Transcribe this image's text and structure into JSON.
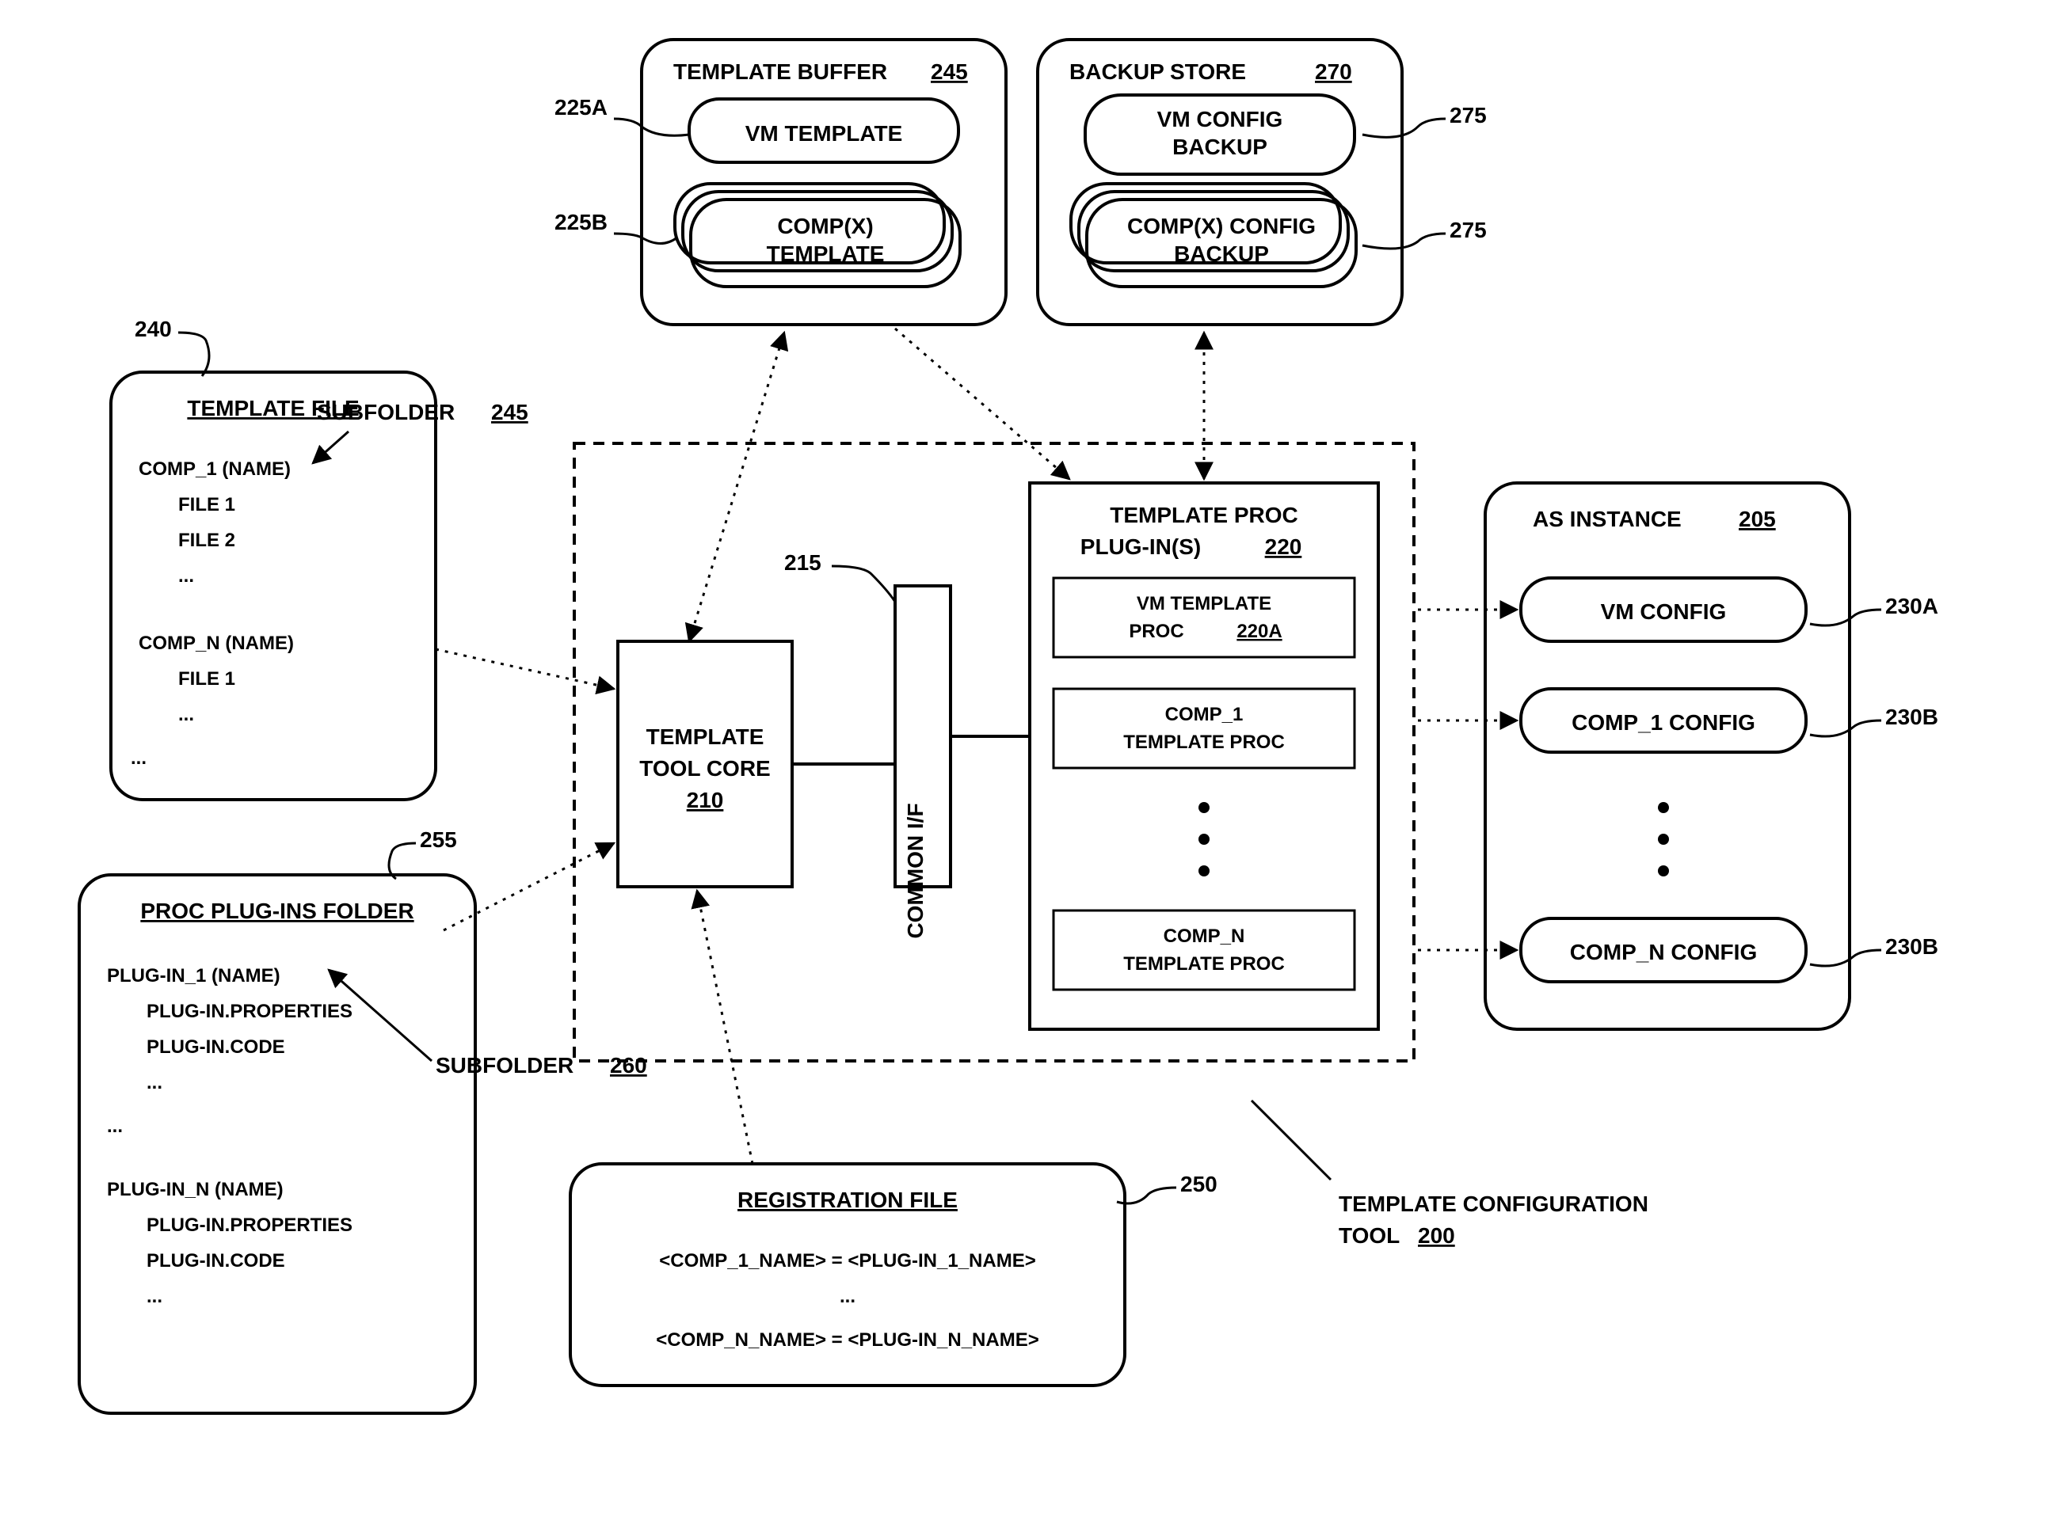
{
  "refs": {
    "r240": "240",
    "r225A": "225A",
    "r225B": "225B",
    "r245a": "245",
    "r245b": "245",
    "r270": "270",
    "r275a": "275",
    "r275b": "275",
    "r215": "215",
    "r210": "210",
    "r220": "220",
    "r220A": "220A",
    "r205": "205",
    "r230A": "230A",
    "r230Bt": "230B",
    "r230Bb": "230B",
    "r255": "255",
    "r260": "260",
    "r250": "250",
    "r200": "200"
  },
  "boxes": {
    "templateBufferTitle": "TEMPLATE BUFFER",
    "vmTemplate": "VM TEMPLATE",
    "compXTemplateL1": "COMP(X)",
    "compXTemplateL2": "TEMPLATE",
    "backupStoreTitle": "BACKUP STORE",
    "vmConfigBackupL1": "VM CONFIG",
    "vmConfigBackupL2": "BACKUP",
    "compXBackupL1": "COMP(X) CONFIG",
    "compXBackupL2": "BACKUP",
    "templateFileTitle": "TEMPLATE FILE",
    "tfComp1": "COMP_1 (NAME)",
    "tfFile1": "FILE 1",
    "tfFile2": "FILE 2",
    "tfDots": "...",
    "tfCompN": "COMP_N (NAME)",
    "tfFile1b": "FILE 1",
    "tfDots2": "...",
    "tfDots3": "...",
    "subfolderA": "SUBFOLDER",
    "toolCoreL1": "TEMPLATE",
    "toolCoreL2": "TOOL CORE",
    "commonIF": "COMMON I/F",
    "procTitleL1": "TEMPLATE PROC",
    "procTitleL2": "PLUG-IN(S)",
    "vmProcL1": "VM TEMPLATE",
    "vmProcL2": "PROC",
    "comp1ProcL1": "COMP_1",
    "comp1ProcL2": "TEMPLATE PROC",
    "compNProcL1": "COMP_N",
    "compNProcL2": "TEMPLATE PROC",
    "asInstanceTitle": "AS INSTANCE",
    "vmConfig": "VM CONFIG",
    "comp1Config": "COMP_1 CONFIG",
    "compNConfig": "COMP_N CONFIG",
    "procFolderTitle": "PROC PLUG-INS FOLDER",
    "pf1": "PLUG-IN_1 (NAME)",
    "pfProps": "PLUG-IN.PROPERTIES",
    "pfCode": "PLUG-IN.CODE",
    "pfDots": "...",
    "pfDots2": "...",
    "pfN": "PLUG-IN_N (NAME)",
    "subfolderB": "SUBFOLDER",
    "regTitle": "REGISTRATION FILE",
    "regL1": "<COMP_1_NAME> = <PLUG-IN_1_NAME>",
    "regDots": "...",
    "regL2": "<COMP_N_NAME> = <PLUG-IN_N_NAME>",
    "tctLabelL1": "TEMPLATE CONFIGURATION",
    "tctLabelL2": "TOOL"
  }
}
